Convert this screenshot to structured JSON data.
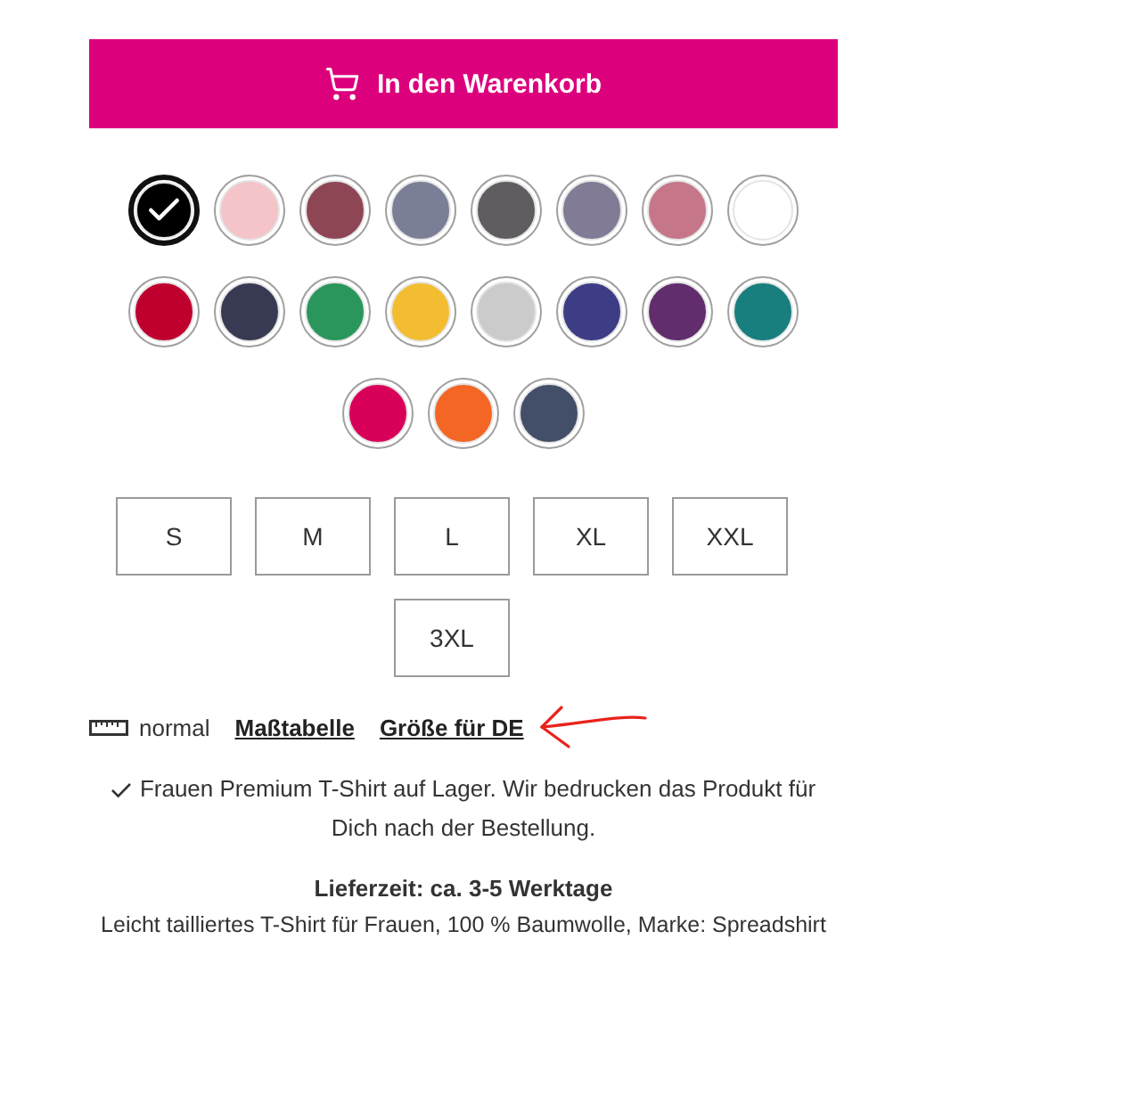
{
  "cart_button": {
    "label": "In den Warenkorb"
  },
  "colors": [
    {
      "color": "#000000",
      "selected": true
    },
    {
      "color": "#f4c4c8",
      "selected": false
    },
    {
      "color": "#8e4655",
      "selected": false
    },
    {
      "color": "#7a7e96",
      "selected": false
    },
    {
      "color": "#5f5d5f",
      "selected": false
    },
    {
      "color": "#817b96",
      "selected": false
    },
    {
      "color": "#c57688",
      "selected": false
    },
    {
      "color": "#ffffff",
      "selected": false
    },
    {
      "color": "#bf002e",
      "selected": false
    },
    {
      "color": "#373a52",
      "selected": false
    },
    {
      "color": "#2a965b",
      "selected": false
    },
    {
      "color": "#f3bd31",
      "selected": false
    },
    {
      "color": "#cbcbcb",
      "selected": false
    },
    {
      "color": "#3d3d86",
      "selected": false
    },
    {
      "color": "#612d6d",
      "selected": false
    },
    {
      "color": "#187e7e",
      "selected": false
    },
    {
      "color": "#d9005a",
      "selected": false
    },
    {
      "color": "#f46623",
      "selected": false
    },
    {
      "color": "#434e69",
      "selected": false
    }
  ],
  "sizes": [
    {
      "label": "S",
      "selected": false
    },
    {
      "label": "M",
      "selected": false
    },
    {
      "label": "L",
      "selected": false
    },
    {
      "label": "XL",
      "selected": false
    },
    {
      "label": "XXL",
      "selected": false
    },
    {
      "label": "3XL",
      "selected": false
    }
  ],
  "size_info": {
    "fit": "normal",
    "links": [
      "Maßtabelle",
      "Größe für DE"
    ]
  },
  "annotation": {
    "kind": "arrow"
  },
  "stock_note": "Frauen Premium T-Shirt auf Lager. Wir bedrucken das Produkt für Dich nach der Bestellung.",
  "delivery": "Lieferzeit: ca. 3-5 Werktage",
  "description": "Leicht tailliertes T-Shirt für Frauen, 100 % Baumwolle, Marke: Spreadshirt"
}
